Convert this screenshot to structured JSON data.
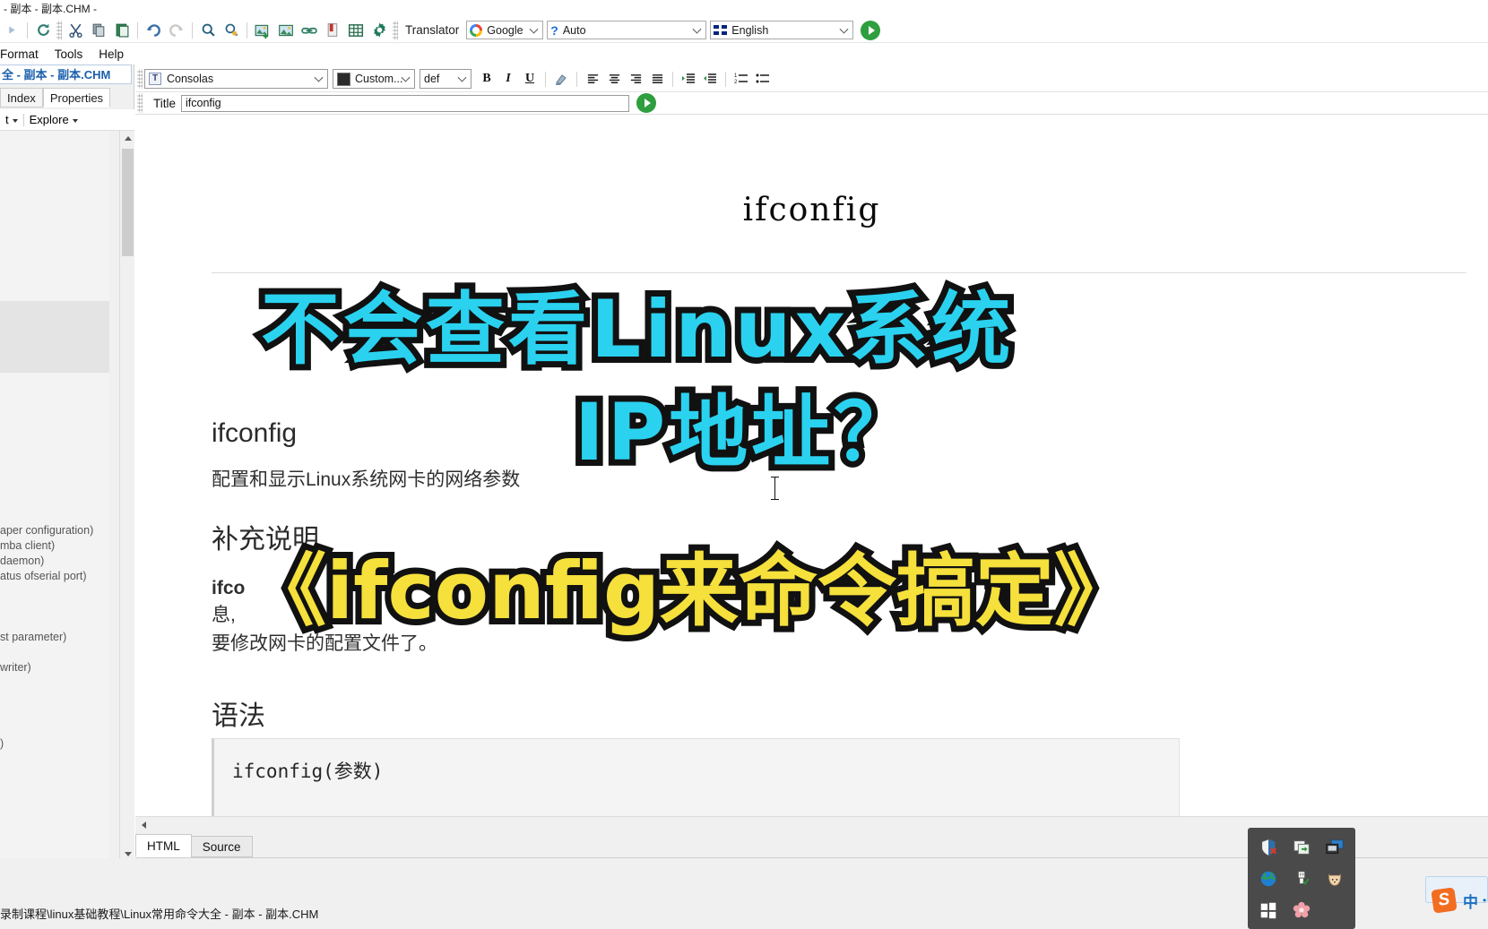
{
  "window": {
    "title": "- 副本 - 副本.CHM -",
    "status_path": "录制课程\\linux基础教程\\Linux常用命令大全 - 副本 - 副本.CHM"
  },
  "toolbar": {
    "icons": [
      {
        "name": "forward-icon",
        "glyph": "▶"
      },
      {
        "name": "refresh-icon",
        "glyph": "⟳"
      },
      {
        "name": "cut-icon",
        "glyph": "✂"
      },
      {
        "name": "copy-icon",
        "glyph": "❐"
      },
      {
        "name": "paste-icon",
        "glyph": "📋"
      },
      {
        "name": "undo-icon",
        "glyph": "↶"
      },
      {
        "name": "redo-icon",
        "glyph": "↷"
      },
      {
        "name": "find-icon",
        "glyph": "🔍"
      },
      {
        "name": "find-replace-icon",
        "glyph": "🔎"
      },
      {
        "name": "insert-image-icon",
        "glyph": "🖼"
      },
      {
        "name": "image-icon",
        "glyph": "🖼"
      },
      {
        "name": "link-icon",
        "glyph": "🔗"
      },
      {
        "name": "bookmark-icon",
        "glyph": "🔖"
      },
      {
        "name": "table-icon",
        "glyph": "▦"
      },
      {
        "name": "settings-icon",
        "glyph": "⚙"
      }
    ],
    "translator_label": "Translator",
    "engine": "Google",
    "source_lang": "Auto",
    "target_lang": "English",
    "run_label": "▶"
  },
  "menubar": {
    "items": [
      "Format",
      "Tools",
      "Help"
    ]
  },
  "left_panel": {
    "doc_tab": "全 - 副本 - 副本.CHM",
    "tabs": [
      {
        "label": "Index",
        "active": false
      },
      {
        "label": "Properties",
        "active": true
      }
    ],
    "tools": [
      {
        "label": "t",
        "caret": true
      },
      {
        "label": "Explore",
        "caret": true
      }
    ],
    "tree_items": [
      "aper configuration)",
      "mba client)",
      " daemon)",
      "atus ofserial port)",
      "st parameter)",
      "writer)",
      ")"
    ]
  },
  "format_bar": {
    "font": "Consolas",
    "color": "Custom...",
    "size": "def",
    "bold": "B",
    "italic": "I",
    "underline": "U",
    "highlight_icon": "✏",
    "align_left": "≡",
    "align_center": "≡",
    "align_right": "≡",
    "align_justify": "≡",
    "indent_increase": "⇥",
    "indent_decrease": "⇤",
    "ordered_list": "⒈",
    "unordered_list": "•"
  },
  "title_field": {
    "label": "Title",
    "value": "ifconfig",
    "placeholder": "",
    "go_label": "▶"
  },
  "document": {
    "heading": "ifconfig",
    "section1_heading": "ifconfig",
    "section1_text": "配置和显示Linux系统网卡的网络参数",
    "section2_heading": "补充说明",
    "section2_line1": "ifco",
    "section2_line2": "息,",
    "section2_line3": "要修改网卡的配置文件了。",
    "section3_heading": "语法",
    "code": "ifconfig(参数)"
  },
  "overlay": {
    "line1": "不会查看Linux系统",
    "line2": "IP地址？",
    "line3": "《ifconfig来命令搞定》",
    "cyan": "#2ad2ef",
    "yellow": "#f5e03c",
    "outline": "#111111"
  },
  "bottom_tabs": [
    {
      "label": "HTML",
      "active": true
    },
    {
      "label": "Source",
      "active": false
    }
  ],
  "dock": {
    "icons": [
      {
        "name": "shield-icon",
        "glyph": "🛡"
      },
      {
        "name": "window-copy-icon",
        "glyph": "🗗"
      },
      {
        "name": "monitor-icon",
        "glyph": "🖥"
      },
      {
        "name": "globe-icon",
        "glyph": "🌐"
      },
      {
        "name": "usb-icon",
        "glyph": "🔌"
      },
      {
        "name": "fox-icon",
        "glyph": "🐱"
      },
      {
        "name": "windows-icon",
        "glyph": "❖"
      },
      {
        "name": "flower-icon",
        "glyph": "✿"
      }
    ]
  },
  "tray": {
    "ime_logo": "S",
    "ime_mode": "中",
    "ime_extra": "•"
  }
}
